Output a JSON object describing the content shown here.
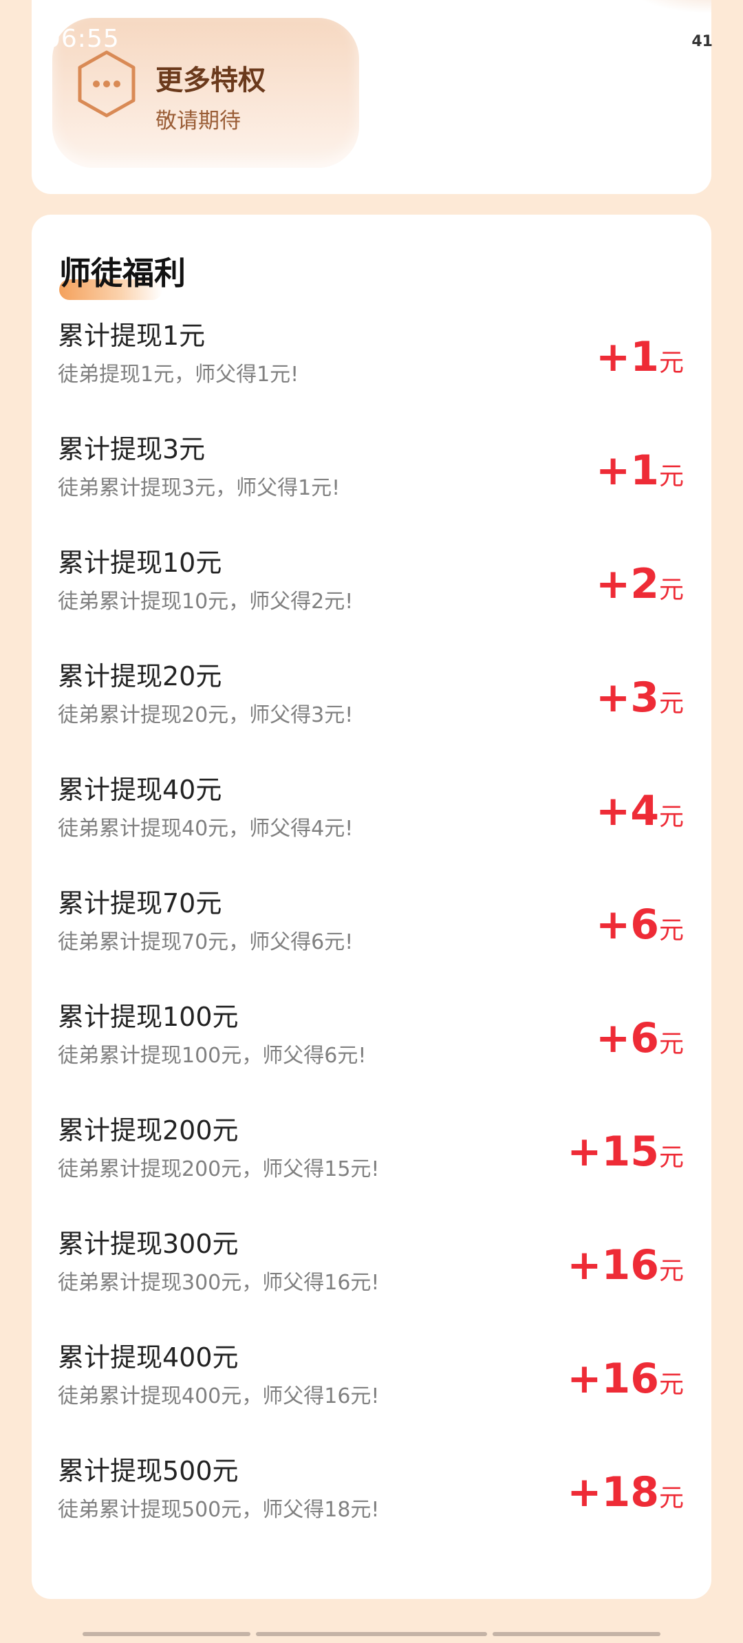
{
  "status_bar": {
    "time": "06:55",
    "battery": "41"
  },
  "more_privilege": {
    "title": "更多特权",
    "subtitle": "敬请期待",
    "icon": "more-dots-hexagon-icon"
  },
  "welfare": {
    "title": "师徒福利",
    "unit": "元",
    "items": [
      {
        "name": "累计提现1元",
        "desc": "徒弟提现1元，师父得1元!",
        "amount": "+1"
      },
      {
        "name": "累计提现3元",
        "desc": "徒弟累计提现3元，师父得1元!",
        "amount": "+1"
      },
      {
        "name": "累计提现10元",
        "desc": "徒弟累计提现10元，师父得2元!",
        "amount": "+2"
      },
      {
        "name": "累计提现20元",
        "desc": "徒弟累计提现20元，师父得3元!",
        "amount": "+3"
      },
      {
        "name": "累计提现40元",
        "desc": "徒弟累计提现40元，师父得4元!",
        "amount": "+4"
      },
      {
        "name": "累计提现70元",
        "desc": "徒弟累计提现70元，师父得6元!",
        "amount": "+6"
      },
      {
        "name": "累计提现100元",
        "desc": "徒弟累计提现100元，师父得6元!",
        "amount": "+6"
      },
      {
        "name": "累计提现200元",
        "desc": "徒弟累计提现200元，师父得15元!",
        "amount": "+15"
      },
      {
        "name": "累计提现300元",
        "desc": "徒弟累计提现300元，师父得16元!",
        "amount": "+16"
      },
      {
        "name": "累计提现400元",
        "desc": "徒弟累计提现400元，师父得16元!",
        "amount": "+16"
      },
      {
        "name": "累计提现500元",
        "desc": "徒弟累计提现500元，师父得18元!",
        "amount": "+18"
      }
    ]
  },
  "colors": {
    "accent_red": "#ee2b36",
    "background": "#fde9d6",
    "privilege_brown": "#6b3a1c"
  }
}
